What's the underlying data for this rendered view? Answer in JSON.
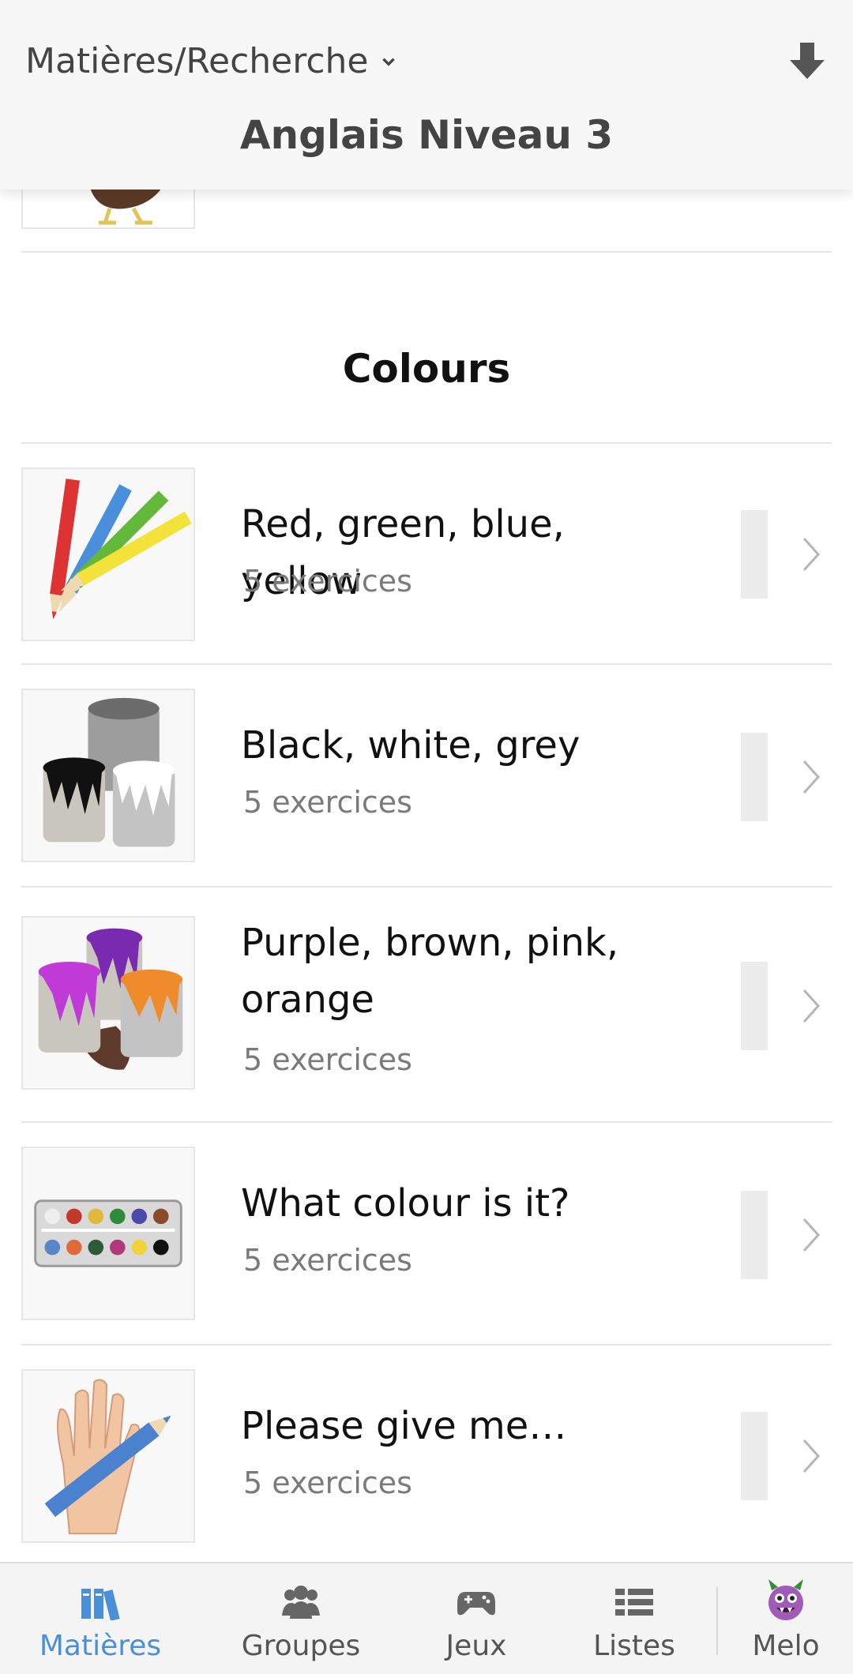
{
  "header": {
    "breadcrumb": "Matières/Recherche",
    "title": "Anglais Niveau 3"
  },
  "section": {
    "title": "Colours"
  },
  "lessons": [
    {
      "title": "Red, green, blue, yellow",
      "subtitle": "5 exercices",
      "image": "colored-pencils-image"
    },
    {
      "title": "Black, white, grey",
      "subtitle": "5 exercices",
      "image": "grey-paint-buckets-image"
    },
    {
      "title": "Purple, brown, pink, orange",
      "subtitle": "5 exercices",
      "image": "colored-paint-buckets-image"
    },
    {
      "title": "What colour is it?",
      "subtitle": "5 exercices",
      "image": "watercolor-palette-image"
    },
    {
      "title": "Please give me…",
      "subtitle": "5 exercices",
      "image": "hand-with-pencil-image"
    }
  ],
  "tabbar": {
    "items": [
      {
        "label": "Matières",
        "icon": "books-icon",
        "active": true
      },
      {
        "label": "Groupes",
        "icon": "group-icon",
        "active": false
      },
      {
        "label": "Jeux",
        "icon": "gamepad-icon",
        "active": false
      },
      {
        "label": "Listes",
        "icon": "list-icon",
        "active": false
      },
      {
        "label": "Melo",
        "icon": "monster-avatar-icon",
        "active": false
      }
    ]
  },
  "colors": {
    "accent": "#4a90d9",
    "progress_track": "#ececec",
    "divider": "#e5e5e5"
  }
}
